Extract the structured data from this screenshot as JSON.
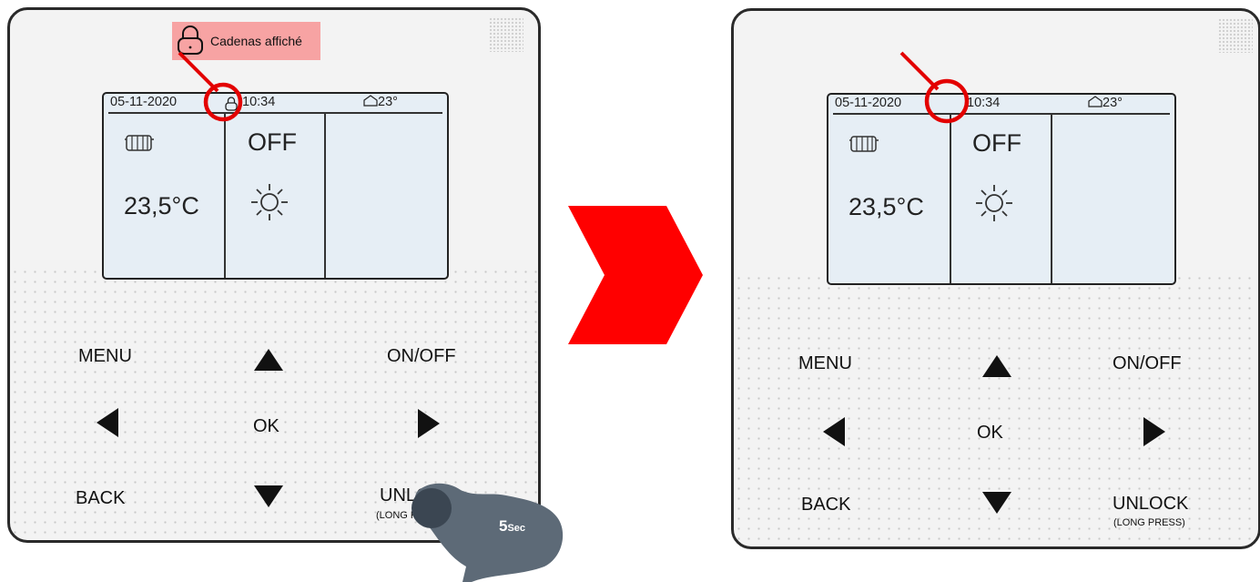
{
  "callout": {
    "text": "Cadenas affiché"
  },
  "press_hint": {
    "duration": "5",
    "unit": "Sec"
  },
  "colors": {
    "highlight": "#e30000",
    "callout_bg": "#f7a3a3",
    "lcd_bg": "#e6eef5",
    "hand": "#5d6a77"
  },
  "panels": [
    {
      "state": "locked",
      "lcd": {
        "date": "05-11-2020",
        "time": "10:34",
        "room_temp": "23°",
        "mode": "OFF",
        "water_temp": "23,5°C",
        "lock_icon": "lock-icon",
        "heat_icon": "radiator-icon",
        "weather_icon": "sun-icon"
      },
      "buttons": {
        "menu": "MENU",
        "on_off": "ON/OFF",
        "ok": "OK",
        "back": "BACK",
        "unlock": "UNLOCK",
        "unlock_hint": "(LONG PRESS)"
      }
    },
    {
      "state": "unlocked",
      "lcd": {
        "date": "05-11-2020",
        "time": "10:34",
        "room_temp": "23°",
        "mode": "OFF",
        "water_temp": "23,5°C",
        "heat_icon": "radiator-icon",
        "weather_icon": "sun-icon"
      },
      "buttons": {
        "menu": "MENU",
        "on_off": "ON/OFF",
        "ok": "OK",
        "back": "BACK",
        "unlock": "UNLOCK",
        "unlock_hint": "(LONG PRESS)"
      }
    }
  ]
}
